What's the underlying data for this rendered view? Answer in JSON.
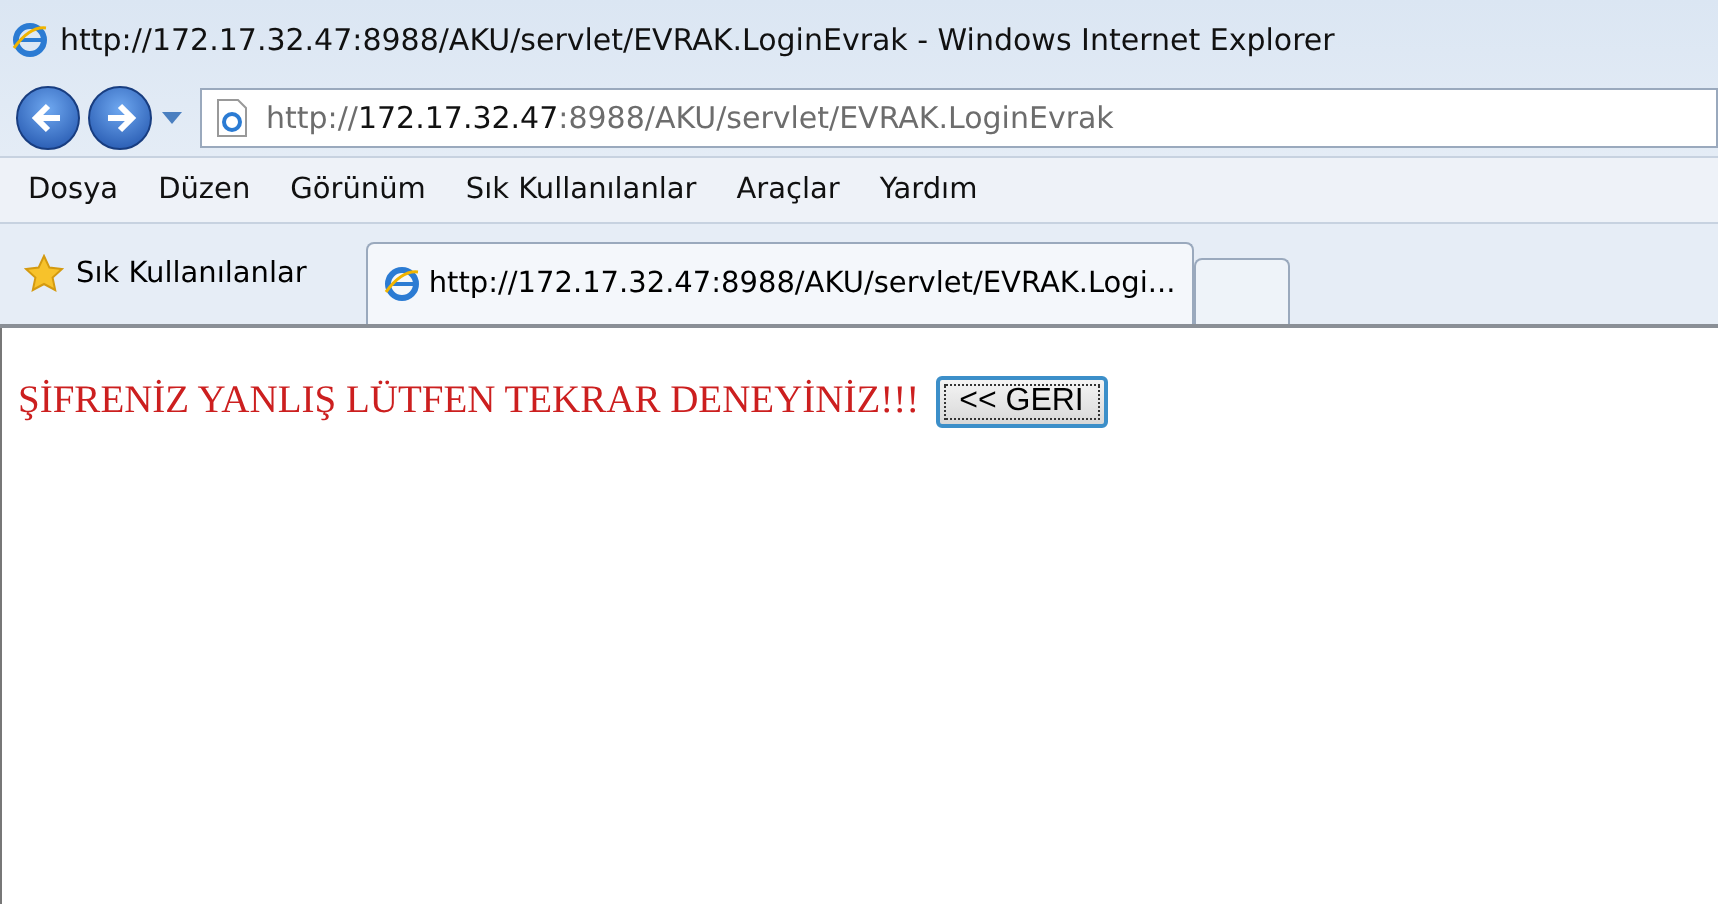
{
  "window": {
    "title": "http://172.17.32.47:8988/AKU/servlet/EVRAK.LoginEvrak - Windows Internet Explorer"
  },
  "address": {
    "scheme": "http://",
    "host": "172.17.32.47",
    "rest": ":8988/AKU/servlet/EVRAK.LoginEvrak"
  },
  "menu": [
    "Dosya",
    "Düzen",
    "Görünüm",
    "Sık Kullanılanlar",
    "Araçlar",
    "Yardım"
  ],
  "favorites": {
    "label": "Sık Kullanılanlar"
  },
  "tabs": [
    {
      "label": "http://172.17.32.47:8988/AKU/servlet/EVRAK.Logi...",
      "selected": true
    }
  ],
  "page": {
    "message": "ŞİFRENİZ YANLIŞ LÜTFEN TEKRAR DENEYİNİZ!!!",
    "button": "<< GERI"
  }
}
